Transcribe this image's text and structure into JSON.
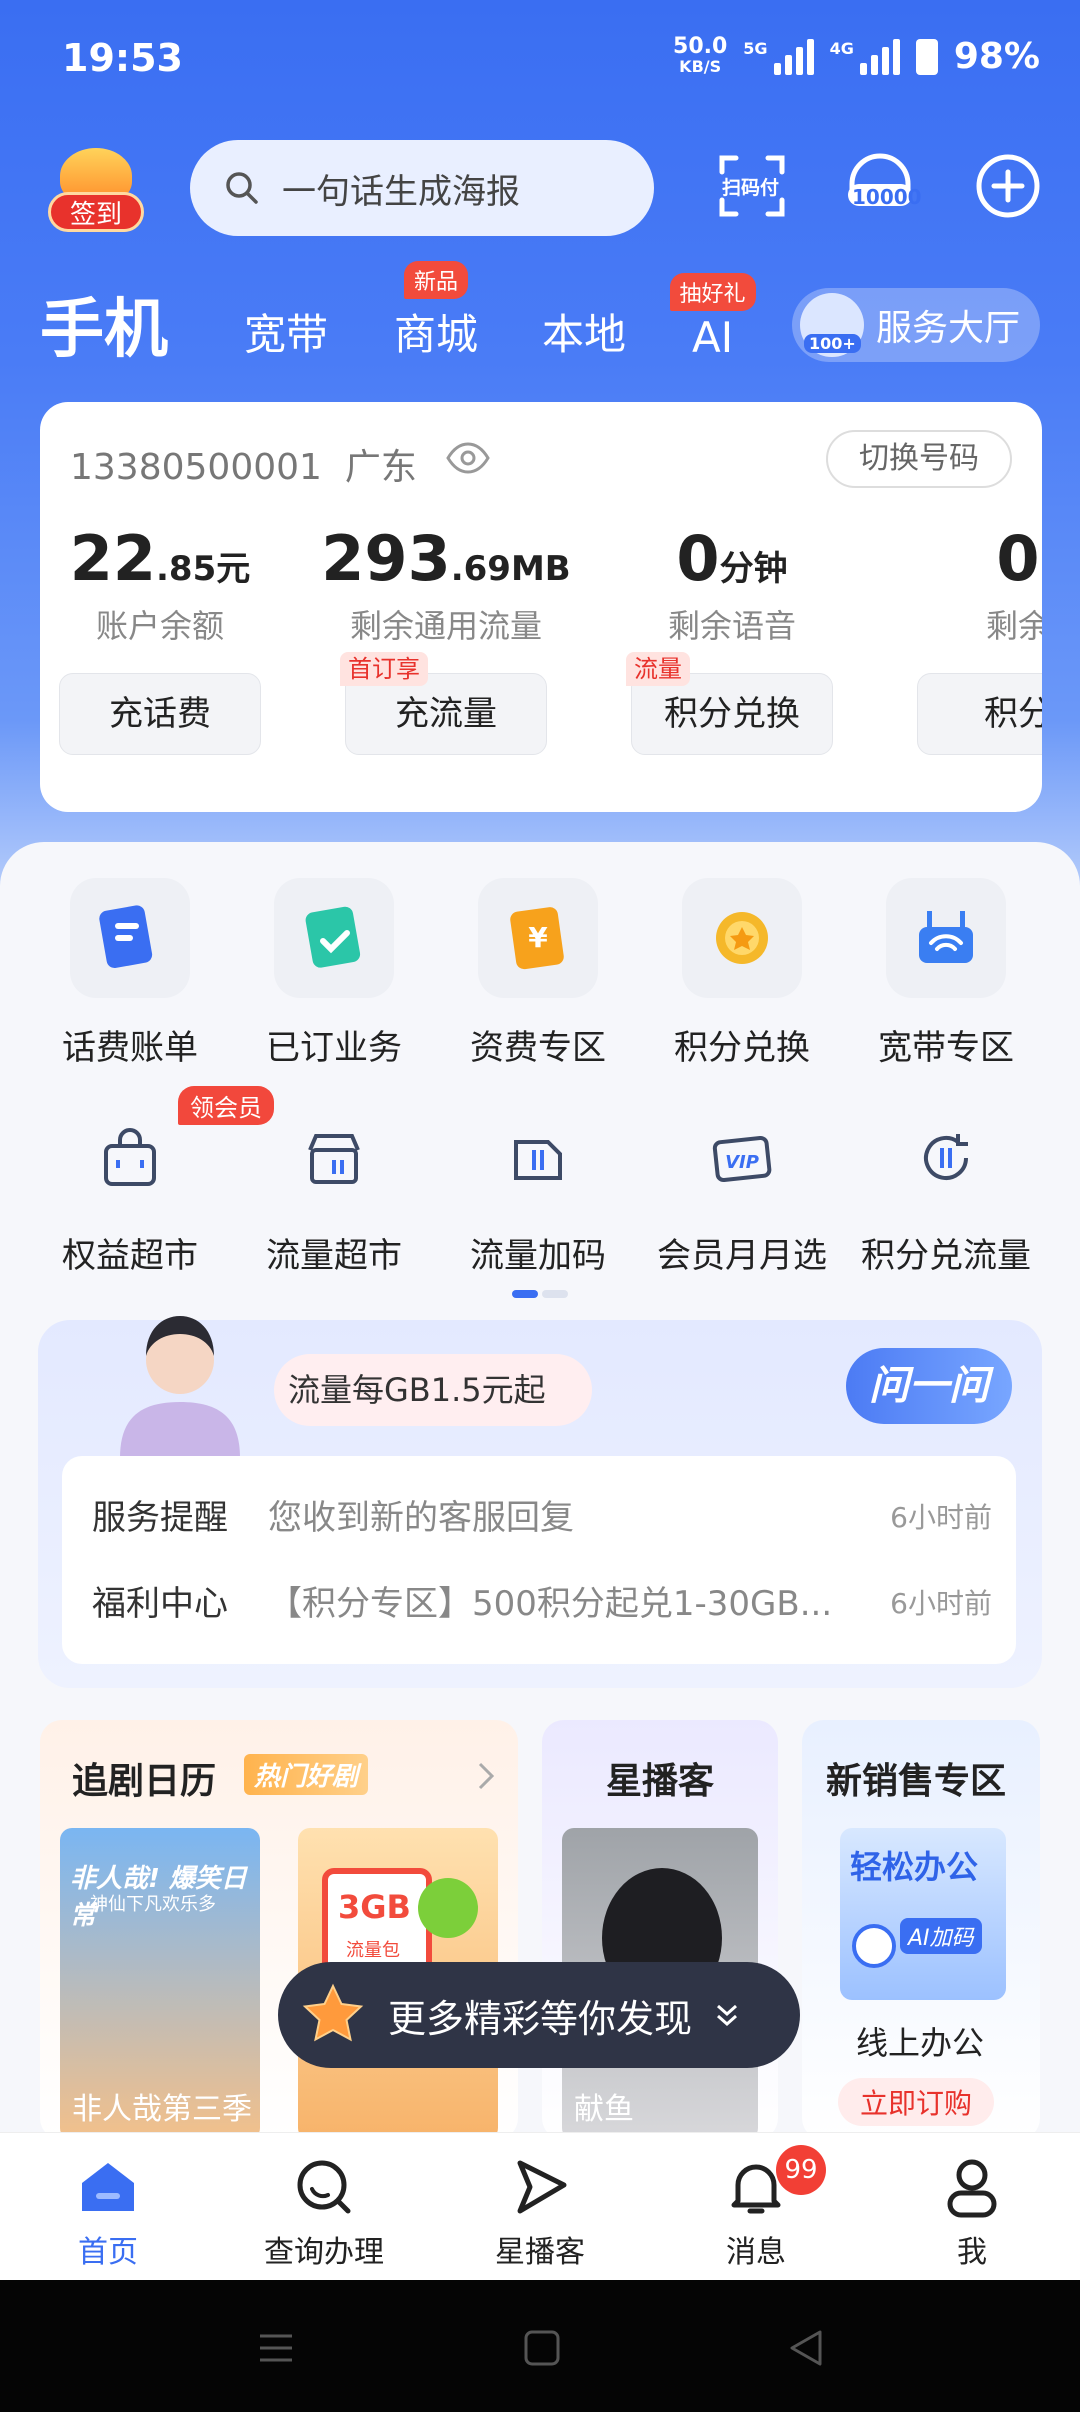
{
  "status": {
    "time": "19:53",
    "speed": "50.0",
    "speed_unit": "KB/S",
    "sim1": "5G",
    "sim2": "4G",
    "battery": "98%"
  },
  "header": {
    "signin_label": "签到",
    "search_placeholder": "一句话生成海报",
    "scan_pay_label": "扫码付",
    "hotline_label": "10000",
    "tabs": [
      {
        "label": "手机",
        "badge": ""
      },
      {
        "label": "宽带",
        "badge": ""
      },
      {
        "label": "商城",
        "badge": "新品"
      },
      {
        "label": "本地",
        "badge": ""
      },
      {
        "label": "AI",
        "badge": "抽好礼"
      }
    ],
    "service_hall": {
      "label": "服务大厅",
      "badge": "100+"
    }
  },
  "account": {
    "phone": "13380500001",
    "region": "广东",
    "switch_label": "切换号码",
    "metrics": [
      {
        "value": "22",
        "decimal": ".85",
        "unit": "元",
        "label": "账户余额",
        "button": "充话费",
        "tag": ""
      },
      {
        "value": "293",
        "decimal": ".69",
        "unit": "MB",
        "label": "剩余通用流量",
        "button": "充流量",
        "tag": "首订享"
      },
      {
        "value": "0",
        "decimal": "",
        "unit": "分钟",
        "label": "剩余语音",
        "button": "积分兑换",
        "tag": "流量"
      },
      {
        "value": "0",
        "decimal": "",
        "unit": "",
        "label": "剩余",
        "button": "积分",
        "tag": ""
      }
    ]
  },
  "grid": [
    {
      "label": "话费账单",
      "badge": "",
      "color": "#3a6ef2"
    },
    {
      "label": "已订业务",
      "badge": "",
      "color": "#2bc6a8"
    },
    {
      "label": "资费专区",
      "badge": "",
      "color": "#f7a21c"
    },
    {
      "label": "积分兑换",
      "badge": "",
      "color": "#f5b82a"
    },
    {
      "label": "宽带专区",
      "badge": "",
      "color": "#3a7ef2"
    },
    {
      "label": "权益超市",
      "badge": "领会员",
      "color": "#3d4a66"
    },
    {
      "label": "流量超市",
      "badge": "",
      "color": "#3d4a66"
    },
    {
      "label": "流量加码",
      "badge": "",
      "color": "#3d4a66"
    },
    {
      "label": "会员月月选",
      "badge": "",
      "color": "#3d4a66"
    },
    {
      "label": "积分兑流量",
      "badge": "",
      "color": "#3d4a66"
    }
  ],
  "service": {
    "bubble": "流量每GB1.5元起",
    "ask_button": "问一问",
    "rows": [
      {
        "key": "服务提醒",
        "value": "您收到新的客服回复",
        "time": "6小时前"
      },
      {
        "key": "福利中心",
        "value": "【积分专区】500积分起兑1-30GB...",
        "time": "6小时前"
      }
    ]
  },
  "cards": {
    "drama": {
      "title": "追剧日历",
      "tag": "热门好剧",
      "poster1_caption": "非人哉第三季",
      "poster1_text1": "非人哉! 爆笑日常",
      "poster1_text2": "神仙下凡欢乐多",
      "poster2_text": "3GB",
      "poster2_sub": "流量包"
    },
    "live": {
      "title": "星播客",
      "poster_caption": "献鱼"
    },
    "sales": {
      "title": "新销售专区",
      "banner": "轻松办公",
      "banner_sub": "AI加码",
      "item": "线上办公",
      "cta": "立即订购"
    }
  },
  "floatbar": {
    "label": "更多精彩等你发现"
  },
  "nav": [
    {
      "label": "首页",
      "active": true,
      "badge": ""
    },
    {
      "label": "查询办理",
      "active": false,
      "badge": ""
    },
    {
      "label": "星播客",
      "active": false,
      "badge": ""
    },
    {
      "label": "消息",
      "active": false,
      "badge": "99"
    },
    {
      "label": "我",
      "active": false,
      "badge": ""
    }
  ],
  "colors": {
    "accent": "#3a6ef2",
    "badge": "#f2483c",
    "nav_active": "#3a6ef2"
  }
}
